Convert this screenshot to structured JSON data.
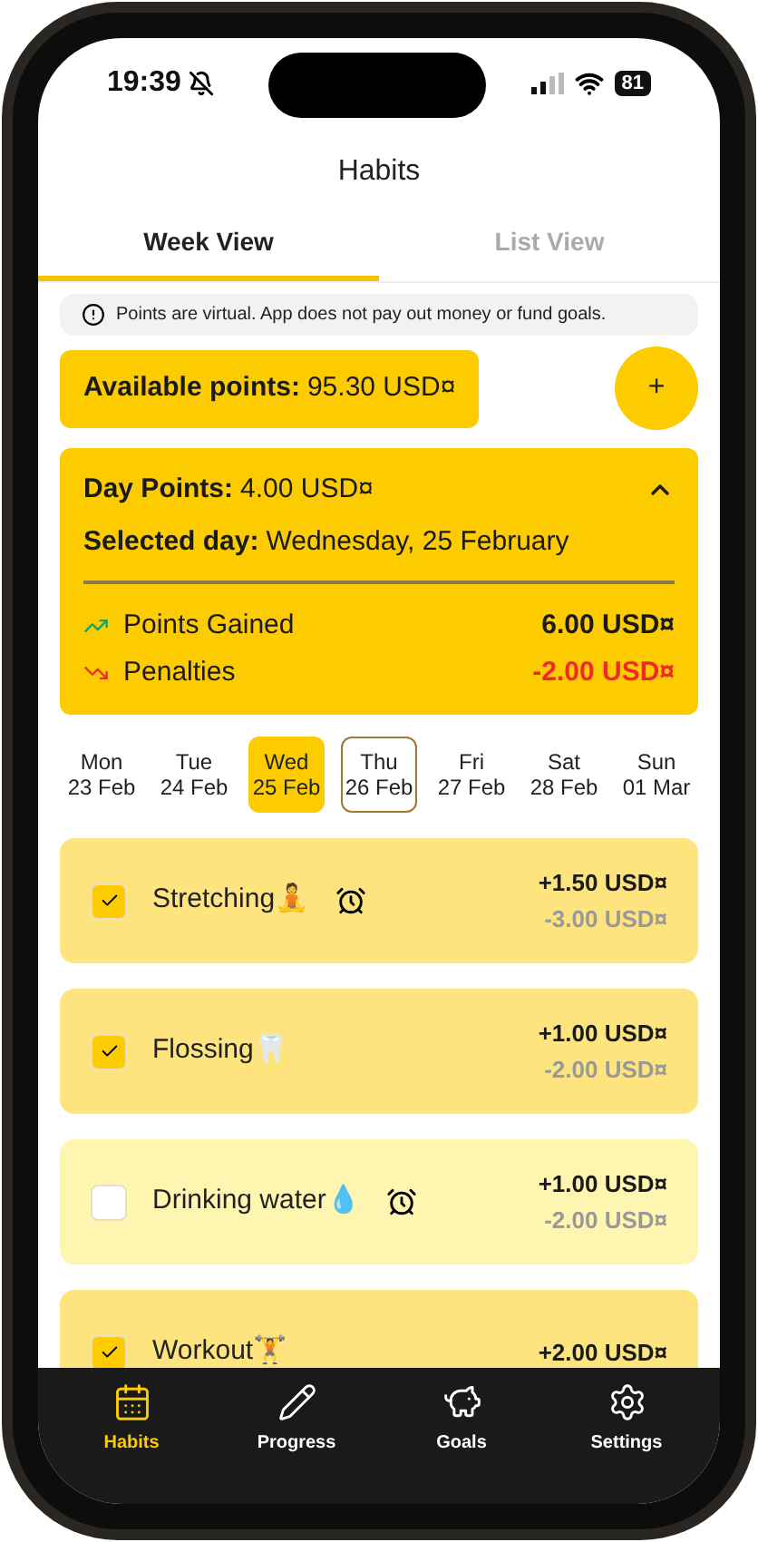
{
  "status_bar": {
    "time": "19:39",
    "silent": true,
    "battery": "81"
  },
  "header": {
    "title": "Habits"
  },
  "tabs": [
    {
      "label": "Week View",
      "selected": true
    },
    {
      "label": "List View",
      "selected": false
    }
  ],
  "notice": {
    "text": "Points are virtual. App does not pay out money or fund goals."
  },
  "available_points": {
    "label": "Available points:",
    "value": "95.30 USD¤"
  },
  "add_button": {
    "label": "+"
  },
  "day_card": {
    "expanded": true,
    "points_label": "Day Points:",
    "points_value": "4.00 USD¤",
    "day_label": "Selected day:",
    "day_value": "Wednesday, 25 February",
    "lines": [
      {
        "kind": "gain",
        "label": "Points Gained",
        "value": "6.00 USD¤"
      },
      {
        "kind": "penalty",
        "label": "Penalties",
        "value": "-2.00 USD¤"
      }
    ]
  },
  "days": [
    {
      "weekday": "Mon",
      "date": "23 Feb",
      "selected": false,
      "today": false
    },
    {
      "weekday": "Tue",
      "date": "24 Feb",
      "selected": false,
      "today": false
    },
    {
      "weekday": "Wed",
      "date": "25 Feb",
      "selected": true,
      "today": false
    },
    {
      "weekday": "Thu",
      "date": "26 Feb",
      "selected": false,
      "today": true
    },
    {
      "weekday": "Fri",
      "date": "27 Feb",
      "selected": false,
      "today": false
    },
    {
      "weekday": "Sat",
      "date": "28 Feb",
      "selected": false,
      "today": false
    },
    {
      "weekday": "Sun",
      "date": "01 Mar",
      "selected": false,
      "today": false
    }
  ],
  "habits": [
    {
      "name": "Stretching🧘",
      "checked": true,
      "reminder": true,
      "reward": "+1.50 USD¤",
      "penalty": "-3.00 USD¤"
    },
    {
      "name": "Flossing🦷",
      "checked": true,
      "reminder": false,
      "reward": "+1.00 USD¤",
      "penalty": "-2.00 USD¤"
    },
    {
      "name": "Drinking water💧",
      "checked": false,
      "reminder": true,
      "reward": "+1.00 USD¤",
      "penalty": "-2.00 USD¤"
    },
    {
      "name": "Workout🏋",
      "checked": true,
      "reminder": false,
      "reward": "+2.00 USD¤"
    }
  ],
  "nav": [
    {
      "kind": "habits",
      "label": "Habits",
      "selected": true
    },
    {
      "kind": "progress",
      "label": "Progress",
      "selected": false
    },
    {
      "kind": "goals",
      "label": "Goals",
      "selected": false
    },
    {
      "kind": "settings",
      "label": "Settings",
      "selected": false
    }
  ]
}
